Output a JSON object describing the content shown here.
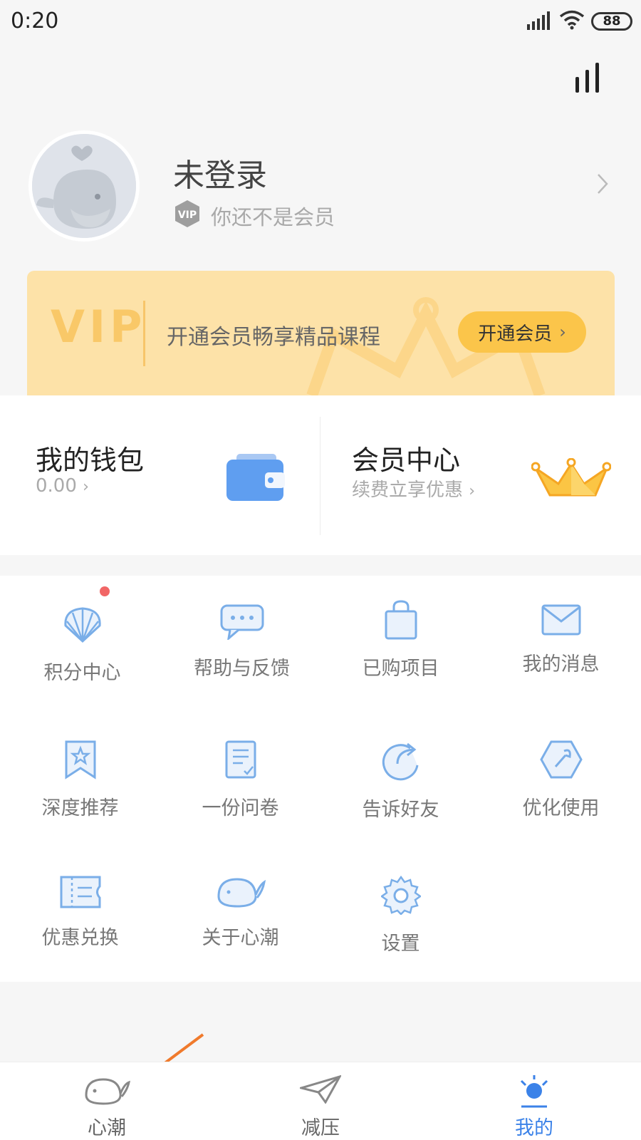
{
  "status_bar": {
    "time": "0:20",
    "battery": "88",
    "icons": [
      "signal-icon",
      "wifi-icon",
      "battery-icon"
    ]
  },
  "header": {
    "action_icon": "bar-chart-icon"
  },
  "profile": {
    "name": "未登录",
    "membership_status": "你还不是会员",
    "badge": "VIP",
    "avatar": "whale-avatar"
  },
  "vip_banner": {
    "logo": "VIP",
    "text": "开通会员畅享精品课程",
    "button": "开通会员"
  },
  "wallet": {
    "title": "我的钱包",
    "balance": "0.00"
  },
  "member_center": {
    "title": "会员中心",
    "subtitle": "续费立享优惠"
  },
  "grid": {
    "items": [
      {
        "label": "积分中心",
        "icon": "shell-icon",
        "has_dot": true
      },
      {
        "label": "帮助与反馈",
        "icon": "chat-bubble-icon"
      },
      {
        "label": "已购项目",
        "icon": "shopping-bag-icon"
      },
      {
        "label": "我的消息",
        "icon": "envelope-icon"
      },
      {
        "label": "深度推荐",
        "icon": "bookmark-star-icon"
      },
      {
        "label": "一份问卷",
        "icon": "survey-icon"
      },
      {
        "label": "告诉好友",
        "icon": "share-icon"
      },
      {
        "label": "优化使用",
        "icon": "wrench-icon"
      },
      {
        "label": "优惠兑换",
        "icon": "coupon-icon"
      },
      {
        "label": "关于心潮",
        "icon": "whale-icon"
      },
      {
        "label": "设置",
        "icon": "gear-icon"
      }
    ]
  },
  "bottom_nav": {
    "tabs": [
      {
        "label": "心潮",
        "icon": "whale-tab-icon"
      },
      {
        "label": "减压",
        "icon": "paper-plane-icon"
      },
      {
        "label": "我的",
        "icon": "profile-tab-icon",
        "active": true
      }
    ]
  },
  "colors": {
    "accent": "#3b82e8",
    "vip_gold": "#fbc54a",
    "icon_blue": "#7aaee8"
  }
}
